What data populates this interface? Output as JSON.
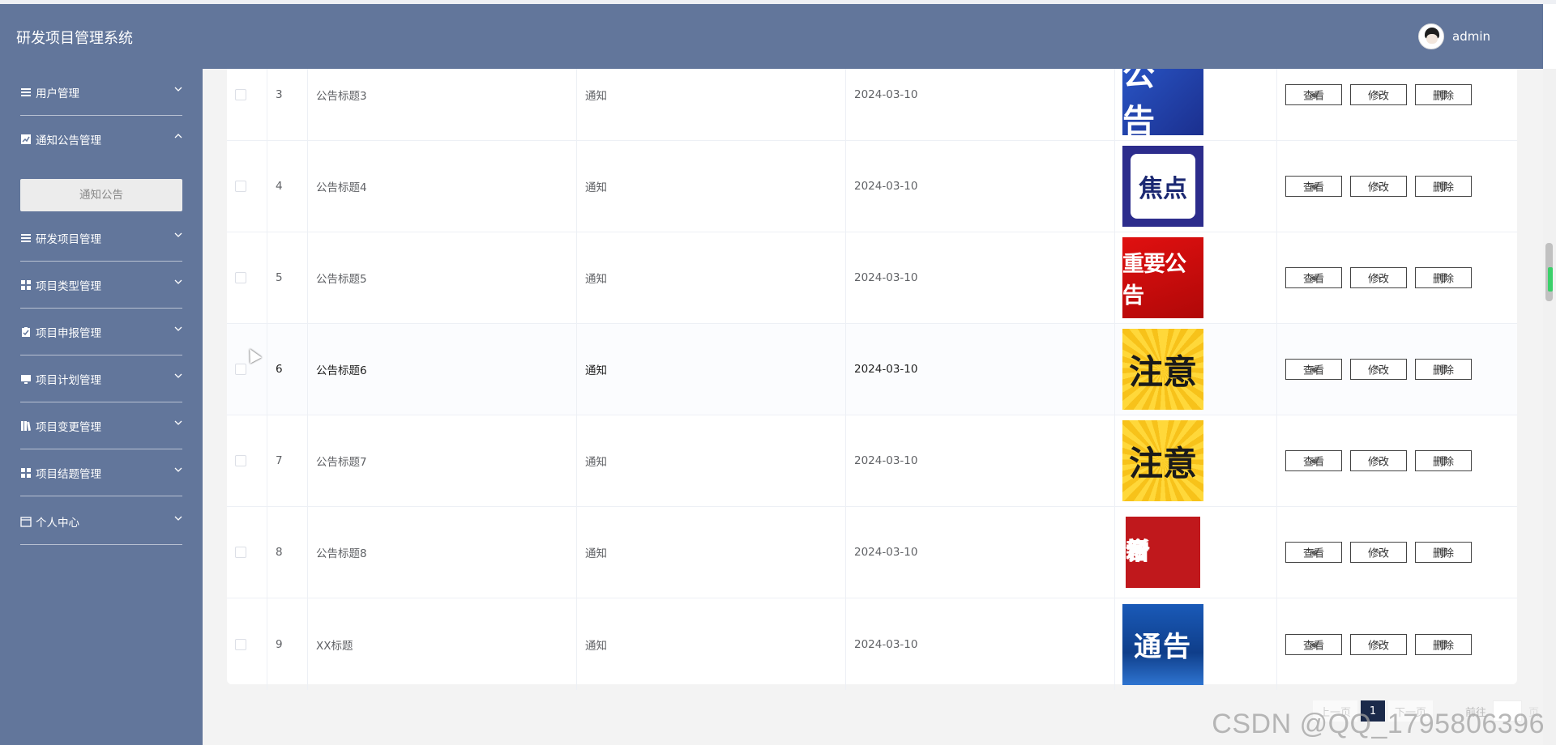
{
  "app": {
    "title": "研发项目管理系统",
    "user": "admin"
  },
  "sidebar": {
    "items": [
      {
        "label": "用户管理",
        "icon": "list-icon",
        "expanded": false
      },
      {
        "label": "通知公告管理",
        "icon": "chart-icon",
        "expanded": true,
        "sub": [
          {
            "label": "通知公告"
          }
        ]
      },
      {
        "label": "研发项目管理",
        "icon": "list-icon",
        "expanded": false
      },
      {
        "label": "项目类型管理",
        "icon": "grid-icon",
        "expanded": false
      },
      {
        "label": "项目申报管理",
        "icon": "clipboard-icon",
        "expanded": false
      },
      {
        "label": "项目计划管理",
        "icon": "monitor-icon",
        "expanded": false
      },
      {
        "label": "项目变更管理",
        "icon": "book-icon",
        "expanded": false
      },
      {
        "label": "项目结题管理",
        "icon": "grid-icon",
        "expanded": false
      },
      {
        "label": "个人中心",
        "icon": "calendar-icon",
        "expanded": false
      }
    ]
  },
  "table": {
    "rows": [
      {
        "index": "3",
        "title": "公告标题3",
        "type": "通知",
        "date": "2024-03-10",
        "image_text": "公告",
        "image_style": "blue"
      },
      {
        "index": "4",
        "title": "公告标题4",
        "type": "通知",
        "date": "2024-03-10",
        "image_text": "焦点",
        "image_style": "navy"
      },
      {
        "index": "5",
        "title": "公告标题5",
        "type": "通知",
        "date": "2024-03-10",
        "image_text": "重要公告",
        "image_style": "red"
      },
      {
        "index": "6",
        "title": "公告标题6",
        "type": "通知",
        "date": "2024-03-10",
        "image_text": "注意",
        "image_style": "yellow"
      },
      {
        "index": "7",
        "title": "公告标题7",
        "type": "通知",
        "date": "2024-03-10",
        "image_text": "注意",
        "image_style": "yellow"
      },
      {
        "index": "8",
        "title": "公告标题8",
        "type": "通知",
        "date": "2024-03-10",
        "image_text": "今日新增",
        "image_style": "today"
      },
      {
        "index": "9",
        "title": "XX标题",
        "type": "通知",
        "date": "2024-03-10",
        "image_text": "通告",
        "image_style": "notice"
      }
    ],
    "actions": {
      "view": "查看",
      "edit": "修改",
      "delete": "删除"
    }
  },
  "pagination": {
    "prev": "上一页",
    "current": "1",
    "next": "下一页",
    "jump_label": "前往",
    "page_suffix": "页"
  },
  "watermark": "CSDN @QQ_1795806396",
  "colors": {
    "header": "#62769b",
    "sidebar": "#62769b",
    "pager_active": "#1b2a4a"
  }
}
